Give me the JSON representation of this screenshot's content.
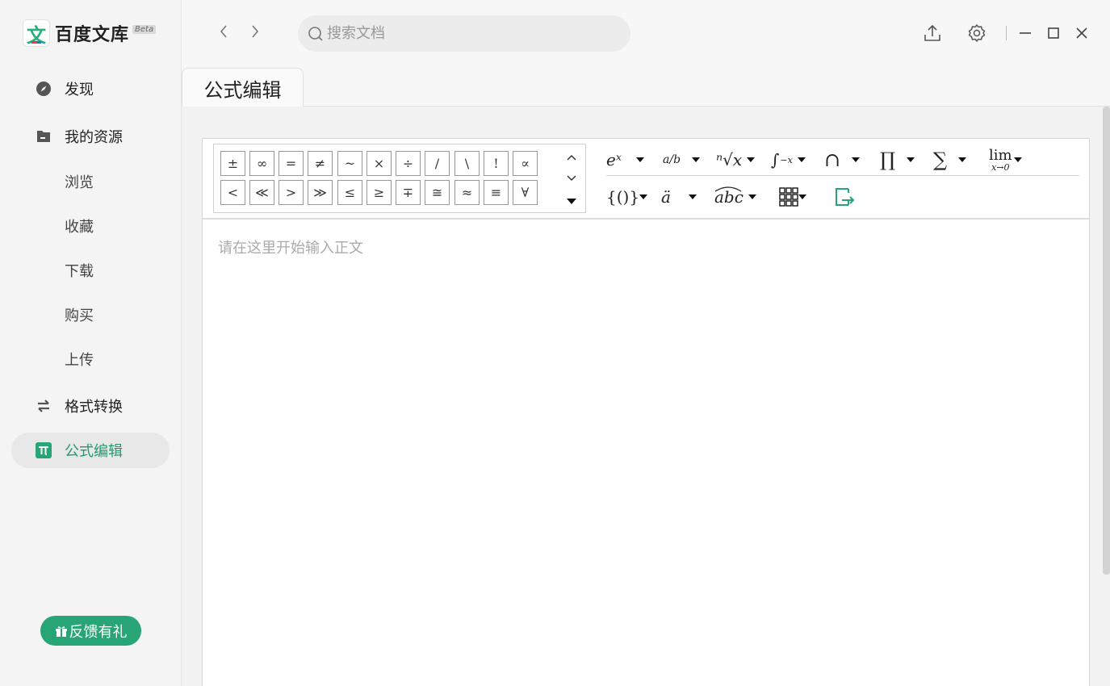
{
  "app": {
    "logo_glyph": "文",
    "logo_text": "百度文库",
    "beta": "Beta"
  },
  "sidebar": {
    "items": [
      {
        "label": "发现",
        "icon": "compass-icon"
      },
      {
        "label": "我的资源",
        "icon": "folder-icon"
      },
      {
        "label": "浏览"
      },
      {
        "label": "收藏"
      },
      {
        "label": "下载"
      },
      {
        "label": "购买"
      },
      {
        "label": "上传"
      },
      {
        "label": "格式转换",
        "icon": "swap-icon"
      },
      {
        "label": "公式编辑",
        "icon": "pi-icon",
        "active": true
      }
    ],
    "feedback_label": "反馈有礼"
  },
  "header": {
    "search_placeholder": "搜索文档"
  },
  "tab": {
    "title": "公式编辑"
  },
  "symbols": {
    "row1": [
      "±",
      "∞",
      "=",
      "≠",
      "~",
      "×",
      "÷",
      "/",
      "\\",
      "!",
      "∝"
    ],
    "row2": [
      "<",
      "≪",
      ">",
      "≫",
      "≤",
      "≥",
      "∓",
      "≅",
      "≈",
      "≡",
      "∀"
    ]
  },
  "templates": {
    "row1": [
      "eˣ",
      "a/b",
      "ⁿ√x",
      "∫",
      "∩",
      "∏",
      "∑",
      "lim"
    ],
    "row2": [
      "{()}",
      "ä",
      "abc",
      "matrix",
      "insert"
    ]
  },
  "editor": {
    "placeholder": "请在这里开始输入正文"
  },
  "colors": {
    "accent": "#27a575",
    "active_text": "#1f9c6c"
  }
}
